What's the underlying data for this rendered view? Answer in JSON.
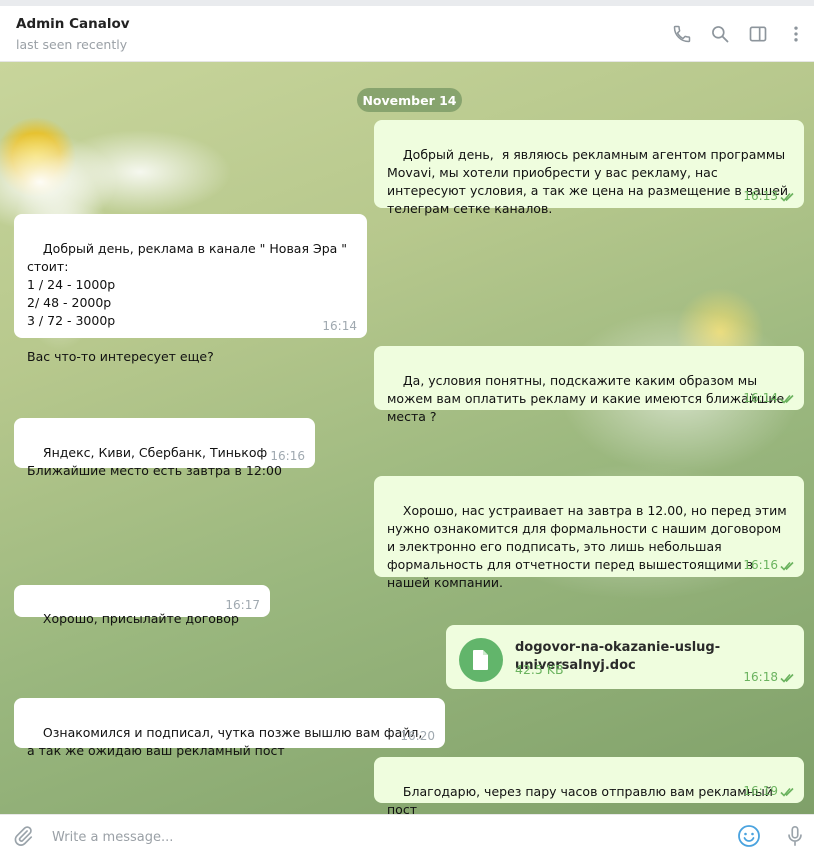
{
  "header": {
    "name": "Admin Canalov",
    "status": "last seen recently",
    "icons": [
      "phone-icon",
      "search-icon",
      "sidebar-panel-icon",
      "more-vertical-icon"
    ]
  },
  "chat": {
    "date_label": "November 14",
    "messages": [
      {
        "dir": "out",
        "text": "Добрый день,  я являюсь рекламным агентом программы Movavi, мы хотели приобрести у вас рекламу, нас интересуют условия, а так же цена на размещение в вашей телеграм сетке каналов.",
        "time": "16:13"
      },
      {
        "dir": "in",
        "text": "Добрый день, реклама в канале \" Новая Эра \"  стоит:\n1 / 24 - 1000р\n2/ 48 - 2000р\n3 / 72 - 3000р\n\nВас что-то интересует еще?",
        "time": "16:14"
      },
      {
        "dir": "out",
        "text": "Да, условия понятны, подскажите каким образом мы можем вам оплатить рекламу и какие имеются ближайшие места ?",
        "time": "16:14"
      },
      {
        "dir": "in",
        "text": "Яндекс, Киви, Сбербанк, Тинькоф\nБлижайшие место есть завтра в 12:00",
        "time": "16:16"
      },
      {
        "dir": "out",
        "text": "Хорошо, нас устраивает на завтра в 12.00, но перед этим нужно ознакомится для формальности с нашим договором и электронно его подписать, это лишь небольшая формальность для отчетности перед вышестоящими в нашей компании.",
        "time": "16:16"
      },
      {
        "dir": "in",
        "text": "Хорошо, присылайте договор",
        "time": "16:17"
      },
      {
        "dir": "out",
        "file": {
          "name": "dogovor-na-okazanie-uslug-universalnyj.doc",
          "size": "42.5 KB"
        },
        "time": "16:18"
      },
      {
        "dir": "in",
        "text": "Ознакомился и подписал, чутка позже вышлю вам файл, а так же ожидаю ваш рекламный пост",
        "time": "16:20"
      },
      {
        "dir": "out",
        "text": "Благодарю, через пару часов отправлю вам рекламный пост",
        "time": "16:19"
      }
    ]
  },
  "composer": {
    "placeholder": "Write a message...",
    "icons": [
      "attach-icon",
      "emoji-icon",
      "microphone-icon"
    ]
  },
  "colors": {
    "outgoing_bubble": "#effdde",
    "incoming_bubble": "#ffffff",
    "accent_green": "#6bb35f",
    "file_icon_bg": "#62b56b"
  }
}
